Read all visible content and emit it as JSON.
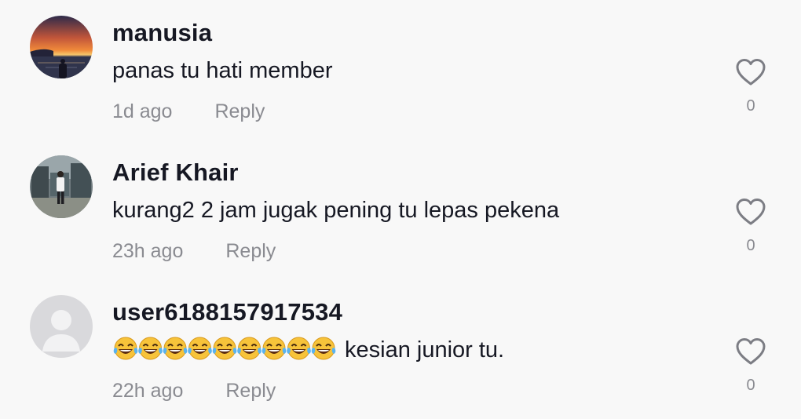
{
  "comments": [
    {
      "username": "manusia",
      "text": "panas tu hati member",
      "emoji": "",
      "time": "1d ago",
      "reply_label": "Reply",
      "likes": "0",
      "avatar": "sunset-photo"
    },
    {
      "username": "Arief Khair",
      "text": "kurang2 2 jam jugak pening tu lepas pekena",
      "emoji": "",
      "time": "23h ago",
      "reply_label": "Reply",
      "likes": "0",
      "avatar": "person-photo"
    },
    {
      "username": "user6188157917534",
      "text": "kesian junior tu.",
      "emoji": "😂😂😂😂😂😂😂😂😂",
      "time": "22h ago",
      "reply_label": "Reply",
      "likes": "0",
      "avatar": "default-avatar"
    }
  ],
  "colors": {
    "background": "#f8f8f8",
    "text": "#161823",
    "secondary": "#8a8b91",
    "icon": "#7c7d84"
  },
  "icons": {
    "like": "heart-outline-icon",
    "default_avatar": "user-silhouette-icon"
  }
}
